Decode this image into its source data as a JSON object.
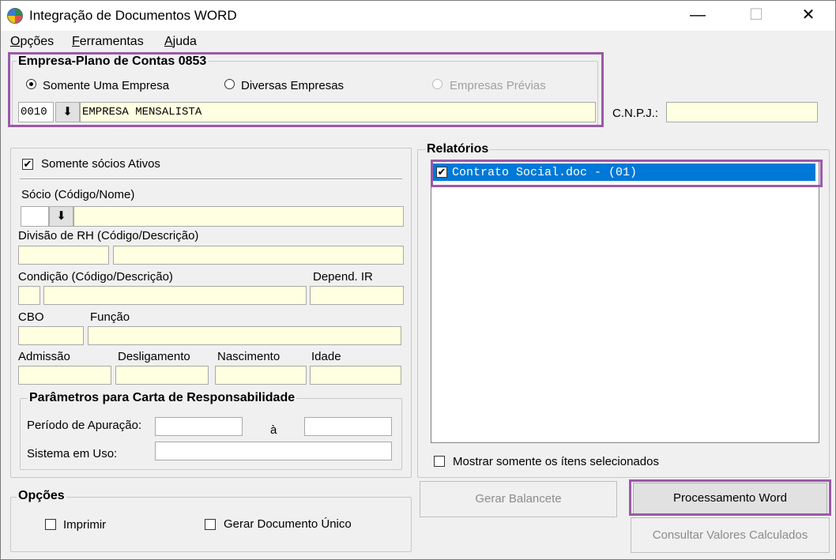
{
  "window": {
    "title": "Integração de Documentos WORD",
    "min_glyph": "—",
    "max_glyph": "☐",
    "close_glyph": "✕"
  },
  "menu": [
    {
      "accel": "O",
      "rest": "pções"
    },
    {
      "accel": "F",
      "rest": "erramentas"
    },
    {
      "accel": "A",
      "rest": "juda"
    }
  ],
  "empresa": {
    "group_title": "Empresa-Plano de Contas 0853",
    "radio_somente": "Somente Uma Empresa",
    "radio_diversas": "Diversas Empresas",
    "radio_previas": "Empresas Prévias",
    "selected_radio": "somente",
    "codigo": "0010",
    "lookup_glyph": "⬇",
    "nome": "EMPRESA MENSALISTA",
    "cnpj_label": "C.N.P.J.:",
    "cnpj_value": ""
  },
  "socios": {
    "somente_ativos_label": "Somente sócios Ativos",
    "somente_ativos_checked": true,
    "socio_label": "Sócio (Código/Nome)",
    "lookup_glyph": "⬇",
    "divisao_label": "Divisão de RH (Código/Descrição)",
    "condicao_label": "Condição (Código/Descrição)",
    "depend_ir_label": "Depend. IR",
    "cbo_label": "CBO",
    "funcao_label": "Função",
    "admissao_label": "Admissão",
    "desligamento_label": "Desligamento",
    "nascimento_label": "Nascimento",
    "idade_label": "Idade"
  },
  "carta": {
    "group_title": "Parâmetros para Carta de Responsabilidade",
    "periodo_label": "Período de Apuração:",
    "a_label": "à",
    "sistema_label": "Sistema em Uso:"
  },
  "relatorios": {
    "group_title": "Relatórios",
    "items": [
      {
        "label": "Contrato Social.doc - (01)",
        "checked": true
      }
    ],
    "mostrar_label": "Mostrar somente os ítens selecionados",
    "mostrar_checked": false
  },
  "opcoes": {
    "group_title": "Opções",
    "imprimir_label": "Imprimir",
    "imprimir_checked": false,
    "gerar_unico_label": "Gerar Documento Único",
    "gerar_unico_checked": false
  },
  "buttons": {
    "gerar_balancete": "Gerar Balancete",
    "processamento_word": "Processamento Word",
    "consultar_valores": "Consultar Valores Calculados"
  },
  "colors": {
    "highlight": "#9b59a8",
    "field_bg": "#ffffe1",
    "selection": "#0078d7"
  }
}
